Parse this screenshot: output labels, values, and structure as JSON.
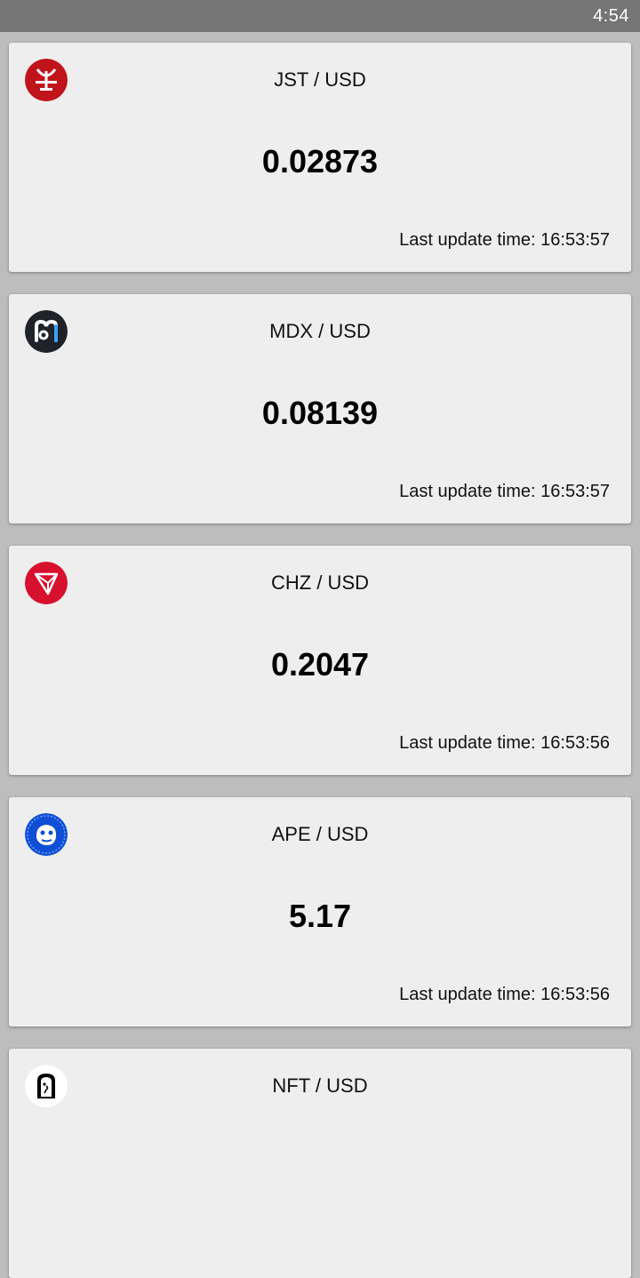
{
  "status_bar": {
    "time": "4:54"
  },
  "cards": [
    {
      "pair": "JST / USD",
      "price": "0.02873",
      "updated_label": "Last update time: ",
      "updated_time": "16:53:57",
      "icon": "jst-logo-icon",
      "color": "#c0141b"
    },
    {
      "pair": "MDX / USD",
      "price": "0.08139",
      "updated_label": "Last update time: ",
      "updated_time": "16:53:57",
      "icon": "mdx-logo-icon",
      "color": "#1f2229"
    },
    {
      "pair": "CHZ / USD",
      "price": "0.2047",
      "updated_label": "Last update time: ",
      "updated_time": "16:53:56",
      "icon": "chz-logo-icon",
      "color": "#d8102f"
    },
    {
      "pair": "APE / USD",
      "price": "5.17",
      "updated_label": "Last update time: ",
      "updated_time": "16:53:56",
      "icon": "ape-logo-icon",
      "color": "#0f4fd6"
    },
    {
      "pair": "NFT / USD",
      "price": "",
      "updated_label": "",
      "updated_time": "",
      "icon": "nft-logo-icon",
      "color": "#000000"
    }
  ]
}
